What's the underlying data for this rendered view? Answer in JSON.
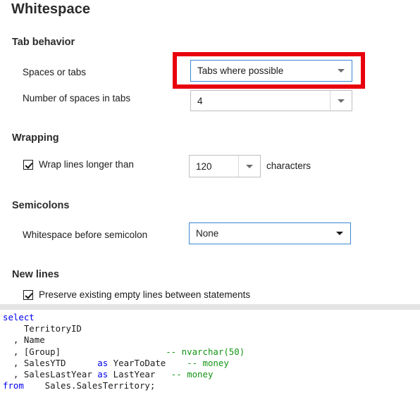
{
  "page_title": "Whitespace",
  "sections": {
    "tab_behavior": {
      "heading": "Tab behavior",
      "spaces_or_tabs": {
        "label": "Spaces or tabs",
        "value": "Tabs where possible",
        "arrow_icon": "chevron-down-icon"
      },
      "number_of_spaces": {
        "label": "Number of spaces in tabs",
        "value": "4",
        "arrow_icon": "chevron-down-icon"
      }
    },
    "wrapping": {
      "heading": "Wrapping",
      "wrap_lines": {
        "label": "Wrap lines longer than",
        "checked": true,
        "check_icon": "checkmark-icon",
        "value": "120",
        "suffix": "characters",
        "arrow_icon": "chevron-down-icon"
      }
    },
    "semicolons": {
      "heading": "Semicolons",
      "whitespace_before_semicolon": {
        "label": "Whitespace before semicolon",
        "value": "None",
        "arrow_icon": "chevron-down-icon"
      }
    },
    "new_lines": {
      "heading": "New lines",
      "preserve_empty_lines": {
        "label": "Preserve existing empty lines between statements",
        "checked": true,
        "check_icon": "checkmark-icon"
      }
    }
  },
  "annotation": {
    "name": "red-highlight-box",
    "color": "#e8000d",
    "targets": "spaces-or-tabs-dropdown"
  },
  "code_preview": {
    "language": "sql",
    "colors": {
      "keyword": "#0000ee",
      "identifier": "#1b1b1b",
      "comment": "#149414"
    },
    "lines": [
      {
        "text": "select",
        "tokens": [
          {
            "t": "select",
            "c": "kw"
          }
        ]
      },
      {
        "text": "    TerritoryID",
        "tokens": [
          {
            "t": "    TerritoryID",
            "c": "id"
          }
        ]
      },
      {
        "text": "  , Name",
        "tokens": [
          {
            "t": "  , Name",
            "c": "id"
          }
        ]
      },
      {
        "text": "  , [Group]                    -- nvarchar(50)",
        "tokens": [
          {
            "t": "  , [Group]                    ",
            "c": "id"
          },
          {
            "t": "-- nvarchar(50)",
            "c": "cmt"
          }
        ]
      },
      {
        "text": "  , SalesYTD      as YearToDate    -- money",
        "tokens": [
          {
            "t": "  , SalesYTD      ",
            "c": "id"
          },
          {
            "t": "as",
            "c": "kw"
          },
          {
            "t": " YearToDate    ",
            "c": "id"
          },
          {
            "t": "-- money",
            "c": "cmt"
          }
        ]
      },
      {
        "text": "  , SalesLastYear as LastYear   -- money",
        "tokens": [
          {
            "t": "  , SalesLastYear ",
            "c": "id"
          },
          {
            "t": "as",
            "c": "kw"
          },
          {
            "t": " LastYear   ",
            "c": "id"
          },
          {
            "t": "-- money",
            "c": "cmt"
          }
        ]
      },
      {
        "text": "from    Sales.SalesTerritory;",
        "tokens": [
          {
            "t": "from",
            "c": "kw"
          },
          {
            "t": "    Sales.SalesTerritory;",
            "c": "id"
          }
        ]
      }
    ]
  }
}
